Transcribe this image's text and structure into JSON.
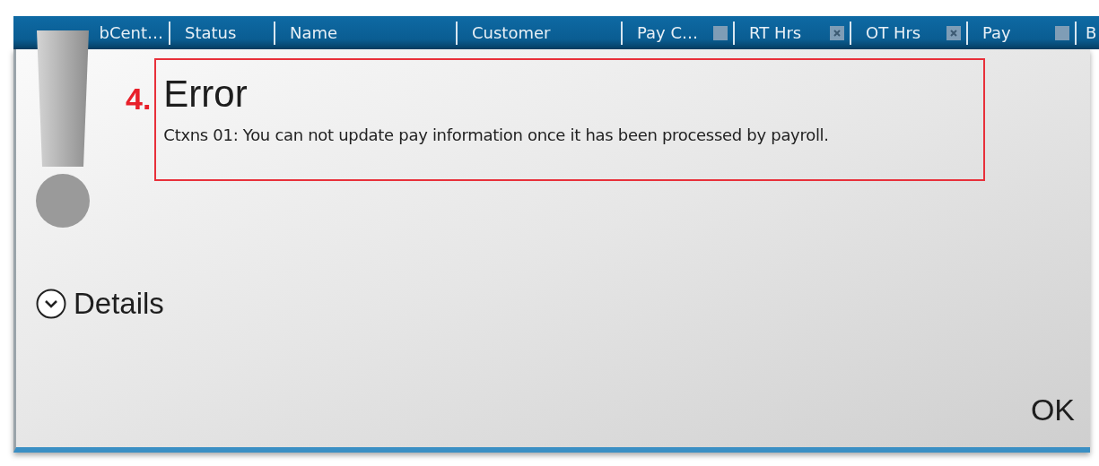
{
  "grid_header": {
    "columns": [
      {
        "label": "bCent…",
        "filter_button": false
      },
      {
        "label": "Status",
        "filter_button": false
      },
      {
        "label": "Name",
        "filter_button": false
      },
      {
        "label": "Customer",
        "filter_button": false
      },
      {
        "label": "Pay C…",
        "filter_button": true,
        "filtered": false
      },
      {
        "label": "RT Hrs",
        "filter_button": true,
        "filtered": true
      },
      {
        "label": "OT Hrs",
        "filter_button": true,
        "filtered": true
      },
      {
        "label": "Pay",
        "filter_button": true,
        "filtered": false
      },
      {
        "label": "B",
        "filter_button": false
      }
    ]
  },
  "dialog": {
    "step_marker": "4.",
    "title": "Error",
    "message": "Ctxns 01: You can not update pay information once it has been processed by payroll.",
    "details": {
      "label": "Details",
      "expanded": false
    },
    "ok_button": "OK"
  }
}
